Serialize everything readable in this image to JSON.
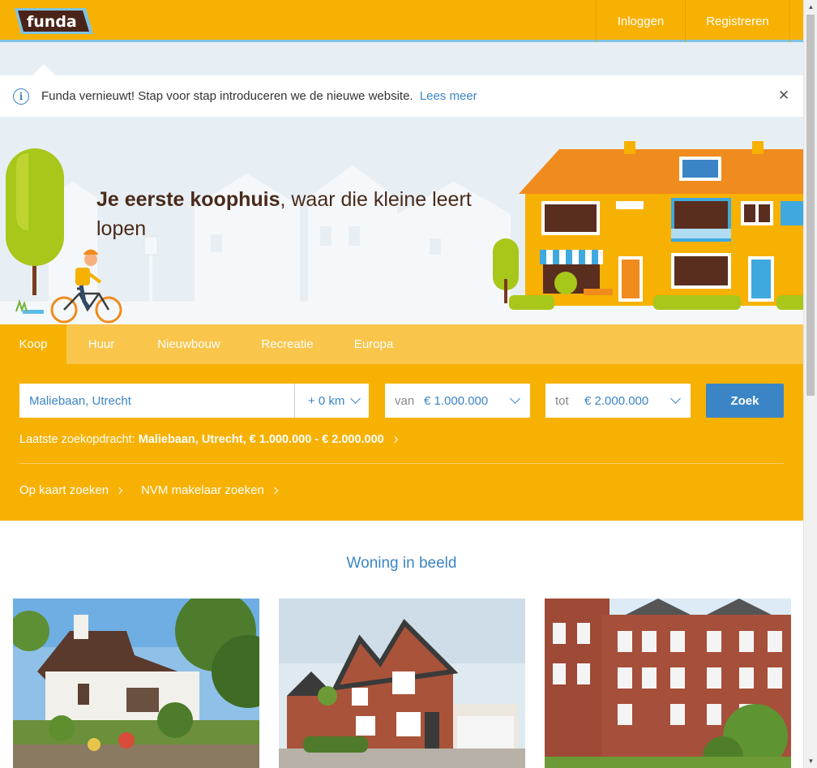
{
  "header": {
    "logo_text": "funda",
    "nav": [
      {
        "label": "Inloggen"
      },
      {
        "label": "Registreren"
      }
    ]
  },
  "notice": {
    "icon": "info-icon",
    "text": "Funda vernieuwt! Stap voor stap introduceren we de nieuwe website.",
    "link_label": "Lees meer",
    "close_icon": "close-icon"
  },
  "hero": {
    "headline_bold": "Je eerste koophuis",
    "headline_rest": ", waar die kleine leert lopen"
  },
  "search": {
    "tabs": [
      {
        "label": "Koop",
        "active": true
      },
      {
        "label": "Huur",
        "active": false
      },
      {
        "label": "Nieuwbouw",
        "active": false
      },
      {
        "label": "Recreatie",
        "active": false
      },
      {
        "label": "Europa",
        "active": false
      }
    ],
    "location_value": "Maliebaan, Utrecht",
    "radius_value": "+ 0 km",
    "price_from_prefix": "van",
    "price_from_value": "€ 1.000.000",
    "price_to_prefix": "tot",
    "price_to_value": "€ 2.000.000",
    "submit_label": "Zoek",
    "last_search_label": "Laatste zoekopdracht:",
    "last_search_value": "Maliebaan, Utrecht, € 1.000.000 - € 2.000.000",
    "links": [
      {
        "label": "Op kaart zoeken"
      },
      {
        "label": "NVM makelaar zoeken"
      }
    ]
  },
  "featured": {
    "title": "Woning in beeld"
  },
  "colors": {
    "brand_yellow": "#f7b102",
    "tab_bar": "#f9c54a",
    "accent_blue": "#3b85c6",
    "hero_bg": "#e8eff4",
    "header_border": "#7fc3e3"
  }
}
